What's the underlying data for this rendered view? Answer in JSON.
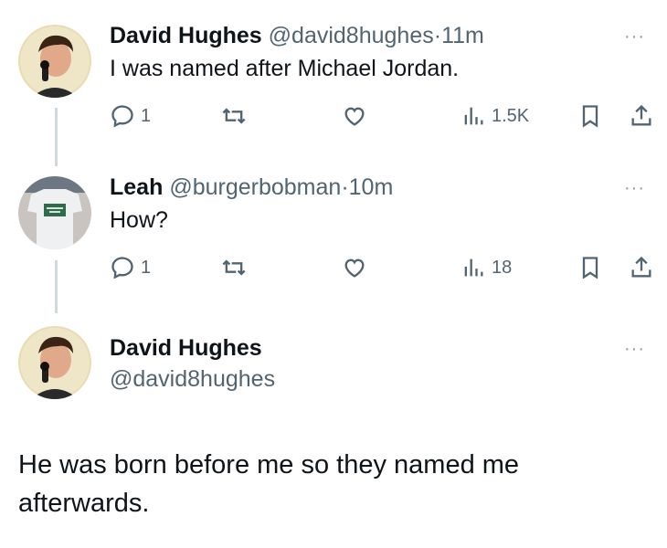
{
  "thread": [
    {
      "name": "David Hughes",
      "handle": "@david8hughes",
      "separator": "·",
      "time": "11m",
      "text": "I was named after Michael Jordan.",
      "replies": "1",
      "views": "1.5K"
    },
    {
      "name": "Leah",
      "handle": "@burgerbobman",
      "separator": "·",
      "time": "10m",
      "text": "How?",
      "replies": "1",
      "views": "18"
    }
  ],
  "main": {
    "name": "David Hughes",
    "handle": "@david8hughes",
    "text_line1": "He was born before me so they named me",
    "text_line2": "afterwards."
  },
  "more_glyph": "···",
  "icons": [
    "reply-icon",
    "retweet-icon",
    "like-icon",
    "views-icon",
    "bookmark-icon",
    "share-icon",
    "more-icon"
  ]
}
